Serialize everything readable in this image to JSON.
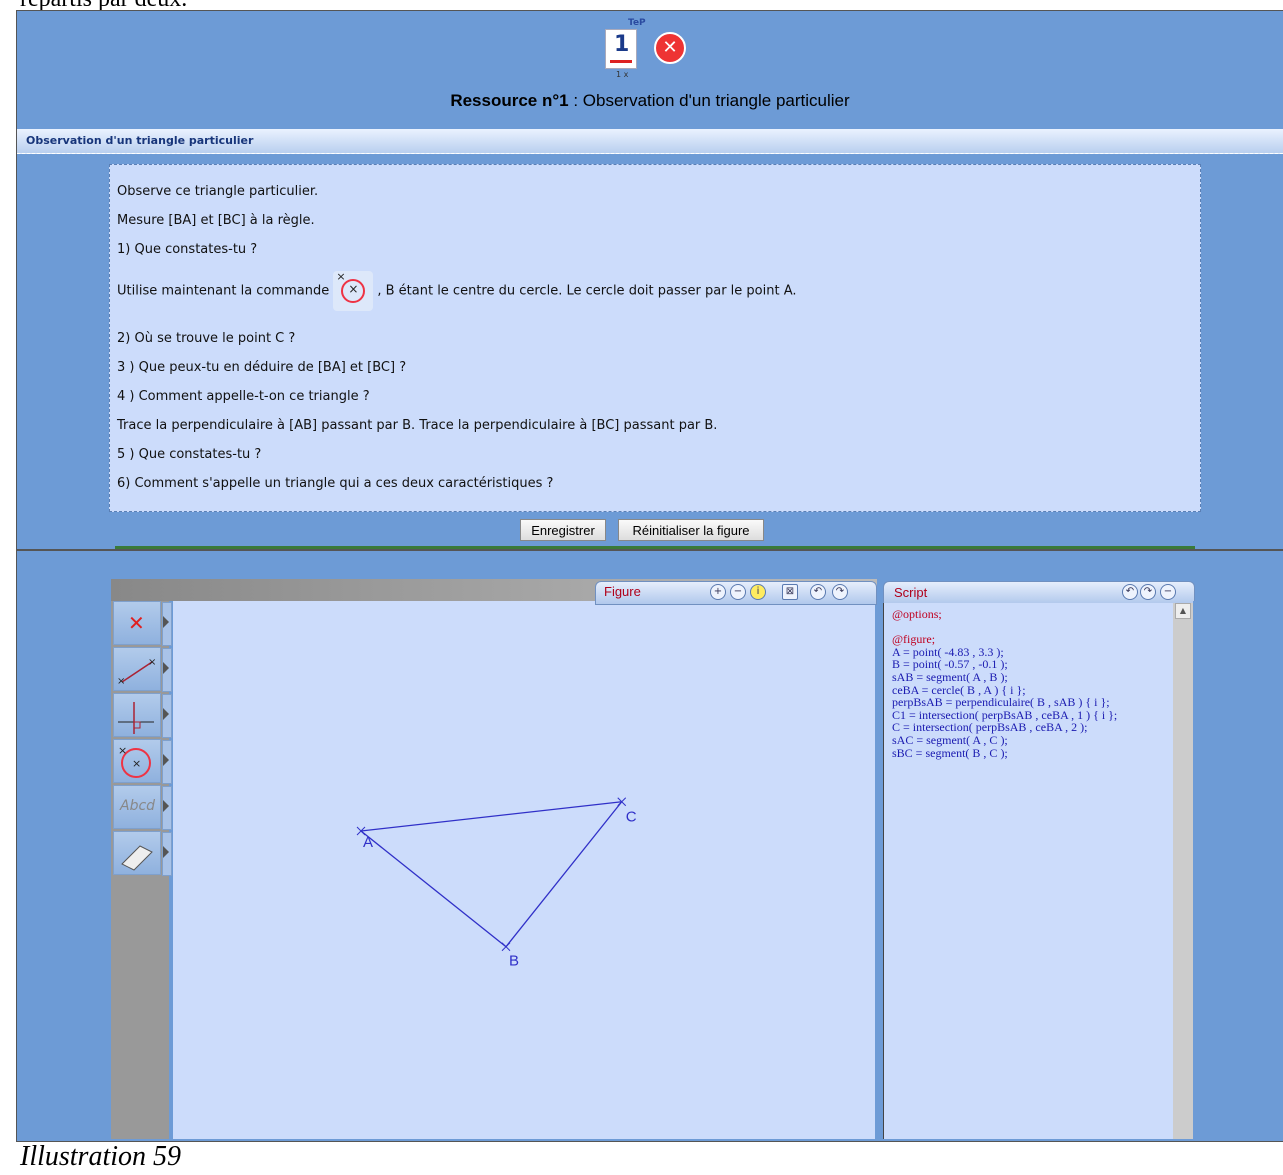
{
  "page": {
    "top_text": "répartis par deux.",
    "caption": "Illustration 59"
  },
  "resource": {
    "title_bold": "Ressource n°1",
    "title_rest": " : Observation d'un triangle particulier",
    "section_title": "Observation d'un triangle particulier",
    "doc_icon_number": "1",
    "doc_icon_badge": "TeP",
    "doc_icon_mult": "1 x",
    "lines": [
      "Observe ce triangle particulier.",
      "Mesure [BA] et [BC] à la règle.",
      "1) Que constates-tu ?",
      "Utilise maintenant la commande",
      ", B étant le centre du cercle. Le cercle doit passer par le point A.",
      "2) Où se trouve le point C ?",
      "3 ) Que peux-tu en déduire de [BA] et [BC] ?",
      "4 ) Comment appelle-t-on ce triangle ?",
      "Trace la perpendiculaire à [AB] passant par B. Trace la perpendiculaire à [BC] passant par B.",
      "5 ) Que constates-tu ?",
      "6) Comment s'appelle un triangle qui a ces deux caractéristiques ?"
    ],
    "buttons": {
      "save": "Enregistrer",
      "reset": "Réinitialiser la figure"
    }
  },
  "figure": {
    "tab_label": "Figure",
    "script_label": "Script",
    "tools": [
      {
        "name": "delete",
        "label": "✕",
        "color": "#e02020"
      },
      {
        "name": "segment",
        "label": ""
      },
      {
        "name": "perpendicular",
        "label": ""
      },
      {
        "name": "circle",
        "label": ""
      },
      {
        "name": "text",
        "label": "Abcd"
      },
      {
        "name": "eraser",
        "label": ""
      }
    ],
    "points": {
      "A": [
        -4.83,
        3.3
      ],
      "B": [
        -0.57,
        -0.1
      ],
      "C": "intersection"
    },
    "point_labels": {
      "A": "A",
      "B": "B",
      "C": "C"
    },
    "script": [
      {
        "text": "@options;",
        "red": true
      },
      {
        "text": "",
        "red": false
      },
      {
        "text": "@figure;",
        "red": true
      },
      {
        "text": " A = point( -4.83 , 3.3 );",
        "red": false
      },
      {
        "text": " B = point( -0.57 , -0.1 );",
        "red": false
      },
      {
        "text": " sAB = segment( A , B );",
        "red": false
      },
      {
        "text": " ceBA = cercle( B , A )  { i };",
        "red": false
      },
      {
        "text": " perpBsAB = perpendiculaire( B , sAB )  { i };",
        "red": false
      },
      {
        "text": " C1 = intersection( perpBsAB , ceBA , 1 )  { i };",
        "red": false
      },
      {
        "text": " C = intersection( perpBsAB , ceBA , 2 );",
        "red": false
      },
      {
        "text": " sAC = segment( A , C );",
        "red": false
      },
      {
        "text": " sBC = segment( B , C );",
        "red": false
      }
    ],
    "colors": {
      "line": "#3030c8",
      "canvas": "#ccdcfb",
      "frame": "#6d9bd6"
    }
  }
}
